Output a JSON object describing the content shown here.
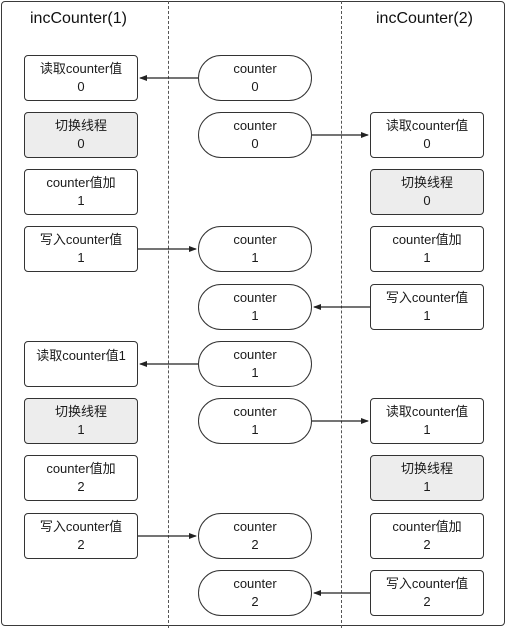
{
  "lanes": {
    "left_title": "incCounter(1)",
    "right_title": "incCounter(2)"
  },
  "colors": {
    "border": "#333333",
    "switch_fill": "#ededed",
    "node_fill": "#ffffff"
  },
  "left_steps": [
    {
      "label": "读取counter值",
      "value": "0",
      "kind": "read"
    },
    {
      "label": "切换线程",
      "value": "0",
      "kind": "switch"
    },
    {
      "label": "counter值加",
      "value": "1",
      "kind": "increment"
    },
    {
      "label": "写入counter值",
      "value": "1",
      "kind": "write"
    },
    {
      "label": "读取counter值1",
      "value": "",
      "kind": "read"
    },
    {
      "label": "切换线程",
      "value": "1",
      "kind": "switch"
    },
    {
      "label": "counter值加",
      "value": "2",
      "kind": "increment"
    },
    {
      "label": "写入counter值",
      "value": "2",
      "kind": "write"
    }
  ],
  "center_states": [
    {
      "label": "counter",
      "value": "0"
    },
    {
      "label": "counter",
      "value": "0"
    },
    {
      "label": "counter",
      "value": "1"
    },
    {
      "label": "counter",
      "value": "1"
    },
    {
      "label": "counter",
      "value": "1"
    },
    {
      "label": "counter",
      "value": "1"
    },
    {
      "label": "counter",
      "value": "2"
    },
    {
      "label": "counter",
      "value": "2"
    }
  ],
  "right_steps": [
    {
      "label": "读取counter值",
      "value": "0",
      "kind": "read"
    },
    {
      "label": "切换线程",
      "value": "0",
      "kind": "switch"
    },
    {
      "label": "counter值加",
      "value": "1",
      "kind": "increment"
    },
    {
      "label": "写入counter值",
      "value": "1",
      "kind": "write"
    },
    {
      "label": "读取counter值",
      "value": "1",
      "kind": "read"
    },
    {
      "label": "切换线程",
      "value": "1",
      "kind": "switch"
    },
    {
      "label": "counter值加",
      "value": "2",
      "kind": "increment"
    },
    {
      "label": "写入counter值",
      "value": "2",
      "kind": "write"
    }
  ],
  "arrows": [
    {
      "from": "center-0",
      "to": "left-0",
      "direction": "left"
    },
    {
      "from": "center-1",
      "to": "right-0",
      "direction": "right"
    },
    {
      "from": "left-3",
      "to": "center-2",
      "direction": "right"
    },
    {
      "from": "right-3",
      "to": "center-3",
      "direction": "left"
    },
    {
      "from": "center-4",
      "to": "left-4",
      "direction": "left"
    },
    {
      "from": "center-5",
      "to": "right-4",
      "direction": "right"
    },
    {
      "from": "left-7",
      "to": "center-6",
      "direction": "right"
    },
    {
      "from": "right-7",
      "to": "center-7",
      "direction": "left"
    }
  ]
}
